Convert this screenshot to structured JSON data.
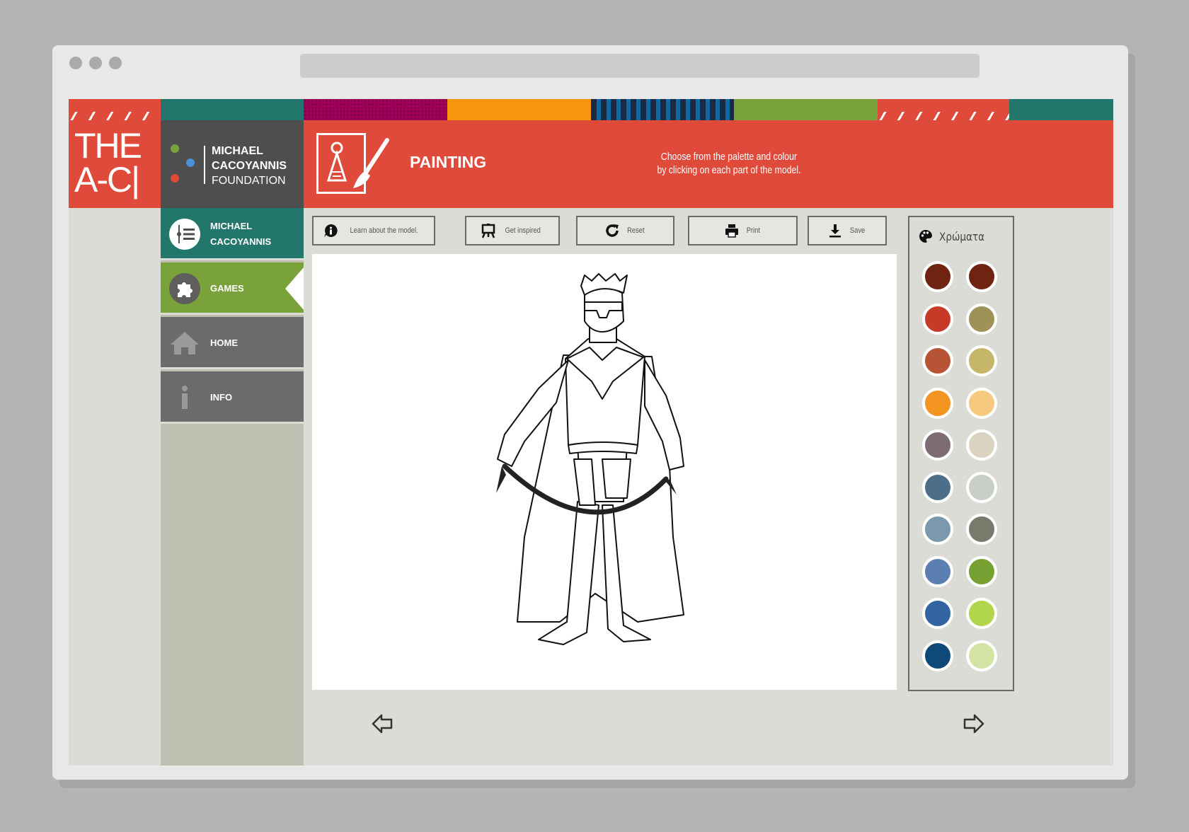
{
  "brand": {
    "logo_line1": "THE",
    "logo_line2": "A-C|",
    "foundation_line1": "MICHAEL",
    "foundation_line2": "CACOYANNIS",
    "foundation_line3": "FOUNDATION"
  },
  "header": {
    "title": "PAINTING",
    "instruction_line1": "Choose from the palette and colour",
    "instruction_line2": "by clicking on each part of the model."
  },
  "nav": [
    {
      "label1": "MICHAEL",
      "label2": "CACOYANNIS",
      "icon": "list-icon",
      "color": "#23766c"
    },
    {
      "label1": "GAMES",
      "icon": "puzzle-icon",
      "color": "#7aa23a",
      "active": true
    },
    {
      "label1": "HOME",
      "icon": "home-icon",
      "color": "#6b6b6b"
    },
    {
      "label1": "INFO",
      "icon": "info-icon",
      "color": "#6b6b6b"
    }
  ],
  "toolbar": {
    "learn": "Learn about the model.",
    "inspired": "Get inspired",
    "reset": "Reset",
    "print": "Print",
    "save": "Save"
  },
  "palette": {
    "title": "Χρώματα",
    "colors": [
      "#6e2411",
      "#6e2411",
      "#c83a28",
      "#9e9256",
      "#b75436",
      "#c5b66a",
      "#f39320",
      "#f6c981",
      "#7e6c74",
      "#dad3bf",
      "#4c6e88",
      "#c7cdc7",
      "#7b99ad",
      "#7a7a6c",
      "#5b7fb3",
      "#77a032",
      "#3164a1",
      "#b2d64b",
      "#0e4979",
      "#d3e3a3"
    ]
  },
  "colors": {
    "accent_red": "#e04a3a",
    "dark_gray": "#4e4e4e",
    "teal": "#23766c",
    "green": "#7aa23a",
    "orange": "#f7960d",
    "magenta": "#a0005a",
    "navy": "#1b3a5c",
    "olive": "#7aa23a"
  }
}
